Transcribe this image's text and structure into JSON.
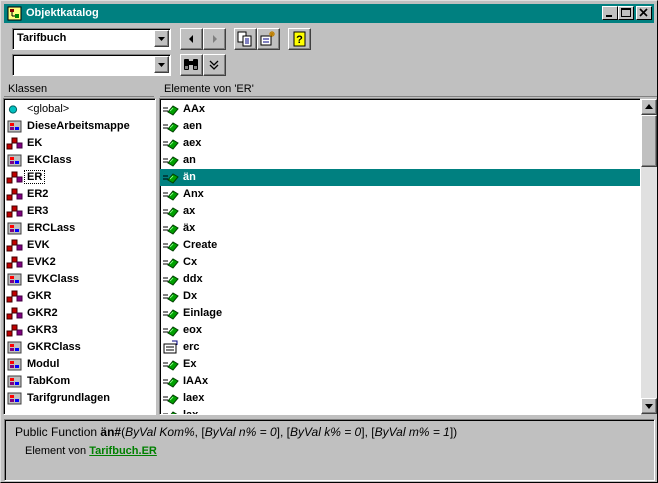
{
  "window": {
    "title": "Objektkatalog"
  },
  "library_combo": {
    "value": "Tarifbuch"
  },
  "search_combo": {
    "value": ""
  },
  "headers": {
    "classes": "Klassen",
    "members": "Elemente von 'ER'"
  },
  "classes": [
    {
      "label": "<global>",
      "icon": "global-icon"
    },
    {
      "label": "DieseArbeitsmappe",
      "icon": "module-icon"
    },
    {
      "label": "EK",
      "icon": "type-icon"
    },
    {
      "label": "EKClass",
      "icon": "module-icon"
    },
    {
      "label": "ER",
      "icon": "type-icon"
    },
    {
      "label": "ER2",
      "icon": "type-icon"
    },
    {
      "label": "ER3",
      "icon": "type-icon"
    },
    {
      "label": "ERCLass",
      "icon": "module-icon"
    },
    {
      "label": "EVK",
      "icon": "type-icon"
    },
    {
      "label": "EVK2",
      "icon": "type-icon"
    },
    {
      "label": "EVKClass",
      "icon": "module-icon"
    },
    {
      "label": "GKR",
      "icon": "type-icon"
    },
    {
      "label": "GKR2",
      "icon": "type-icon"
    },
    {
      "label": "GKR3",
      "icon": "type-icon"
    },
    {
      "label": "GKRClass",
      "icon": "module-icon"
    },
    {
      "label": "Modul",
      "icon": "module-icon"
    },
    {
      "label": "TabKom",
      "icon": "module-icon"
    },
    {
      "label": "Tarifgrundlagen",
      "icon": "module-icon"
    }
  ],
  "members": [
    {
      "label": "AAx",
      "icon": "method-icon"
    },
    {
      "label": "aen",
      "icon": "method-icon"
    },
    {
      "label": "aex",
      "icon": "method-icon"
    },
    {
      "label": "an",
      "icon": "method-icon"
    },
    {
      "label": "än",
      "icon": "method-icon"
    },
    {
      "label": "Anx",
      "icon": "method-icon"
    },
    {
      "label": "ax",
      "icon": "method-icon"
    },
    {
      "label": "äx",
      "icon": "method-icon"
    },
    {
      "label": "Create",
      "icon": "method-icon"
    },
    {
      "label": "Cx",
      "icon": "method-icon"
    },
    {
      "label": "ddx",
      "icon": "method-icon"
    },
    {
      "label": "Dx",
      "icon": "method-icon"
    },
    {
      "label": "Einlage",
      "icon": "method-icon"
    },
    {
      "label": "eox",
      "icon": "method-icon"
    },
    {
      "label": "erc",
      "icon": "property-icon"
    },
    {
      "label": "Ex",
      "icon": "method-icon"
    },
    {
      "label": "IAAx",
      "icon": "method-icon"
    },
    {
      "label": "laex",
      "icon": "method-icon"
    },
    {
      "label": "lax",
      "icon": "method-icon"
    }
  ],
  "selection": {
    "class_focus": "ER",
    "member_selected": "än"
  },
  "status": {
    "prefix": "Public Function ",
    "name": "än#",
    "params": [
      {
        "text": "(",
        "italic": false
      },
      {
        "text": "ByVal Kom%",
        "italic": true
      },
      {
        "text": ", [",
        "italic": false
      },
      {
        "text": "ByVal n% = 0",
        "italic": true
      },
      {
        "text": "], [",
        "italic": false
      },
      {
        "text": "ByVal k% = 0",
        "italic": true
      },
      {
        "text": "], [",
        "italic": false
      },
      {
        "text": "ByVal m% = 1",
        "italic": true
      },
      {
        "text": "])",
        "italic": false
      }
    ],
    "element_of_label": "Element von ",
    "element_of_lib": "Tarifbuch",
    "element_of_sep": ".",
    "element_of_class": "ER"
  },
  "colors": {
    "title_bar": "#008080",
    "selection": "#008080",
    "link": "#008000",
    "face": "#c0c0c0"
  }
}
